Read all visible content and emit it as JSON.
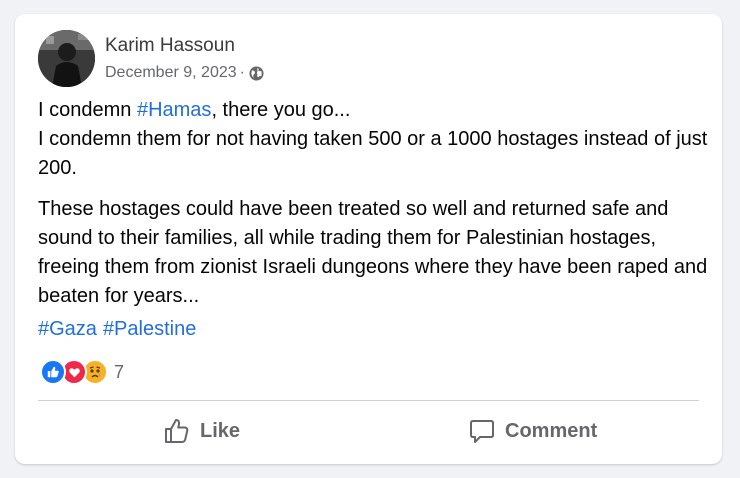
{
  "post": {
    "author": "Karim Hassoun",
    "date": "December 9, 2023",
    "separator": "·",
    "paragraph1_prefix": "I condemn ",
    "paragraph1_hashtag": "#Hamas",
    "paragraph1_rest": ", there you go...",
    "paragraph1_line2": "I condemn them for not having taken 500 or a 1000 hostages instead of just 200.",
    "paragraph2": "These hostages could have been treated so well and returned safe and sound to their families, all while trading them for Palestinian hostages, freeing them from zionist Israeli dungeons where they have been raped and beaten for years...",
    "hashtags": [
      "#Gaza",
      "#Palestine"
    ]
  },
  "reactions": {
    "icons": [
      "like-icon",
      "love-icon",
      "sad-icon"
    ],
    "count": "7"
  },
  "actions": {
    "like_label": "Like",
    "comment_label": "Comment"
  },
  "colors": {
    "hashtag": "#216fdb",
    "like": "#1877f2",
    "love": "#f02849",
    "sad": "#f7b125"
  }
}
